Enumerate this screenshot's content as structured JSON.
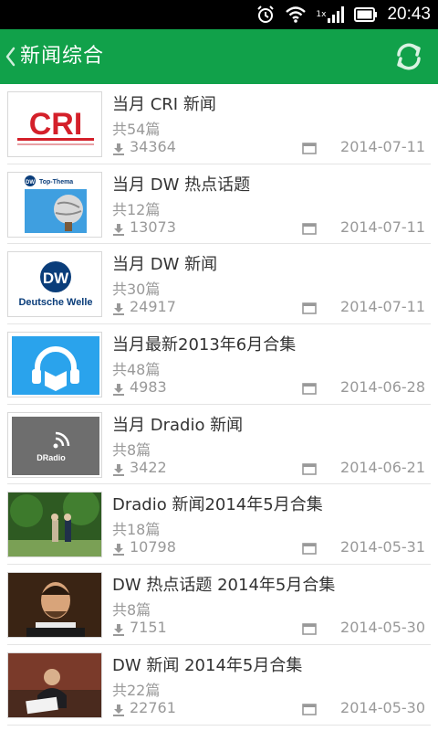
{
  "status_bar": {
    "time": "20:43",
    "network_label": "1x",
    "icons": [
      "alarm-icon",
      "wifi-icon",
      "signal-icon",
      "battery-icon"
    ]
  },
  "app_bar": {
    "title": "新闻综合",
    "back_icon": "chevron-left-icon",
    "refresh_icon": "refresh-icon",
    "color": "#11a14a"
  },
  "thumbnails": {
    "dw_top_label": "Top-Thema",
    "dw_caption": "Deutsche Welle",
    "dradio_caption": "DRadio"
  },
  "items": [
    {
      "title": "当月 CRI 新闻",
      "count": "共54篇",
      "downloads": "34364",
      "date": "2014-07-11"
    },
    {
      "title": "当月 DW 热点话题",
      "count": "共12篇",
      "downloads": "13073",
      "date": "2014-07-11"
    },
    {
      "title": "当月 DW 新闻",
      "count": "共30篇",
      "downloads": "24917",
      "date": "2014-07-11"
    },
    {
      "title": "当月最新2013年6月合集",
      "count": "共48篇",
      "downloads": "4983",
      "date": "2014-06-28"
    },
    {
      "title": "当月 Dradio 新闻",
      "count": "共8篇",
      "downloads": "3422",
      "date": "2014-06-21"
    },
    {
      "title": "Dradio 新闻2014年5月合集",
      "count": "共18篇",
      "downloads": "10798",
      "date": "2014-05-31"
    },
    {
      "title": "DW 热点话题 2014年5月合集",
      "count": "共8篇",
      "downloads": "7151",
      "date": "2014-05-30"
    },
    {
      "title": "DW 新闻 2014年5月合集",
      "count": "共22篇",
      "downloads": "22761",
      "date": "2014-05-30"
    }
  ]
}
